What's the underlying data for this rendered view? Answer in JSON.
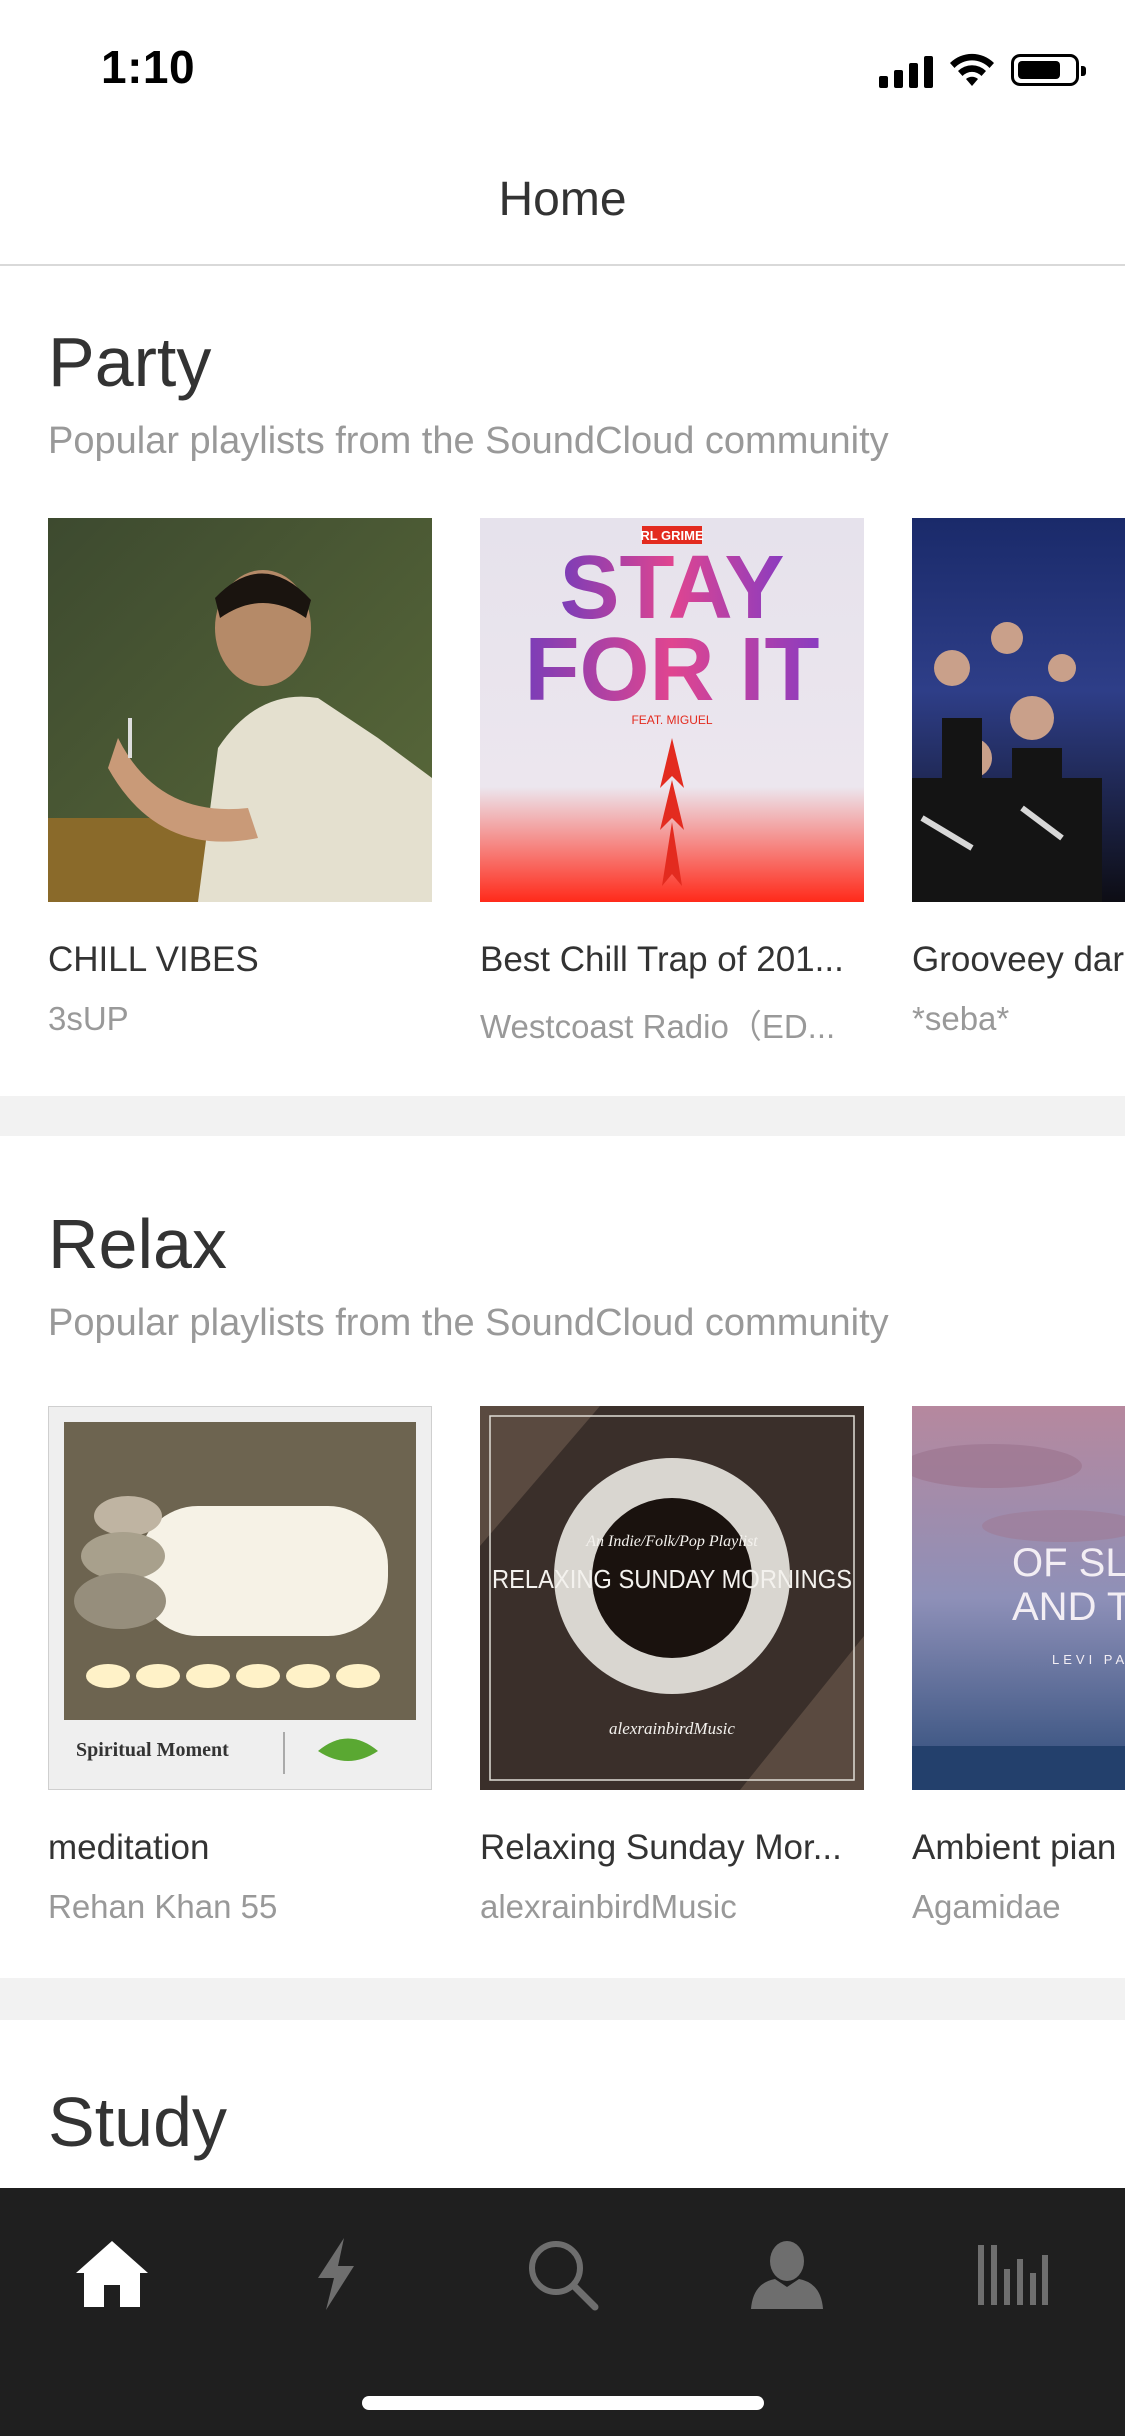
{
  "status_bar": {
    "time": "1:10"
  },
  "nav": {
    "title": "Home"
  },
  "sections": [
    {
      "title": "Party",
      "subtitle": "Popular playlists from the SoundCloud community",
      "playlists": [
        {
          "title": "CHILL VIBES",
          "user": "3sUP"
        },
        {
          "title": "Best Chill Trap of 201...",
          "user": "Westcoast Radio（ED..."
        },
        {
          "title": "Grooveey dar",
          "user": "*seba*"
        }
      ]
    },
    {
      "title": "Relax",
      "subtitle": "Popular playlists from the SoundCloud community",
      "playlists": [
        {
          "title": "meditation",
          "user": "Rehan Khan 55"
        },
        {
          "title": "Relaxing Sunday Mor...",
          "user": "alexrainbirdMusic"
        },
        {
          "title": "Ambient pian",
          "user": "Agamidae"
        }
      ]
    },
    {
      "title": "Study"
    }
  ],
  "artwork_text": {
    "stay_for_it_artist": "RL GRIME",
    "stay_for_it_line1": "STAY",
    "stay_for_it_line2": "FOR IT",
    "stay_for_it_feat": "FEAT. MIGUEL",
    "spiritual_moment": "Spiritual Moment",
    "sunday_line1": "An Indie/Folk/Pop Playlist",
    "sunday_line2": "RELAXING SUNDAY MORNINGS",
    "sunday_signature": "alexrainbirdMusic",
    "ambient_line1": "OF SL",
    "ambient_line2": "AND T",
    "ambient_line3": "LEVI PAT"
  },
  "tab_bar": {
    "tabs": [
      {
        "icon": "home-icon",
        "active": true
      },
      {
        "icon": "lightning-icon",
        "active": false
      },
      {
        "icon": "search-icon",
        "active": false
      },
      {
        "icon": "profile-icon",
        "active": false
      },
      {
        "icon": "library-icon",
        "active": false
      }
    ]
  },
  "colors": {
    "tab_active": "#ffffff",
    "tab_inactive": "#6e6e6e",
    "tab_bar_bg": "#1f1f1f",
    "accent_red": "#ff2a1a"
  }
}
